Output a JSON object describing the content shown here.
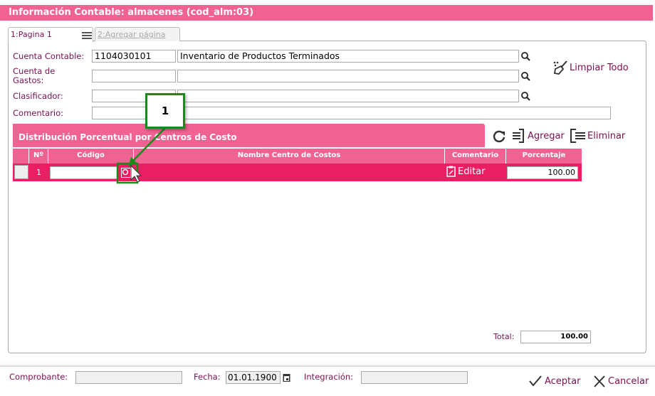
{
  "window": {
    "title": "Información Contable: almacenes (cod_alm:03)"
  },
  "tabs": [
    {
      "label": "1:Pagina 1"
    },
    {
      "label": "2:Agregar página"
    }
  ],
  "form": {
    "cuenta_contable": {
      "label": "Cuenta Contable:",
      "code": "1104030101",
      "name": "Inventario de Productos Terminados"
    },
    "cuenta_gastos": {
      "label": "Cuenta de Gastos:",
      "code": "",
      "name": ""
    },
    "clasificador": {
      "label": "Clasificador:",
      "code": "",
      "name": ""
    },
    "comentario": {
      "label": "Comentario:",
      "value": ""
    },
    "limpiar_label": "Limpiar Todo"
  },
  "section": {
    "title": "Distribución Porcentual por Centros de Costo",
    "agregar_label": "Agregar",
    "eliminar_label": "Eliminar"
  },
  "table": {
    "headers": [
      "Nº",
      "Código",
      "Nombre Centro de Costos",
      "Comentario",
      "Porcentaje"
    ],
    "rows": [
      {
        "n": "1",
        "codigo": "",
        "nombre": "",
        "comentario": "Editar",
        "porcentaje": "100.00"
      }
    ],
    "total_label": "Total:",
    "total": "100.00"
  },
  "callout": {
    "label": "1"
  },
  "footer": {
    "comprobante_label": "Comprobante:",
    "comprobante": "",
    "fecha_label": "Fecha:",
    "fecha": "01.01.1900",
    "integracion_label": "Integración:",
    "integracion": "",
    "aceptar_label": "Aceptar",
    "cancelar_label": "Cancelar"
  },
  "colors": {
    "accent": "#f06292",
    "row": "#e91e63",
    "label": "#7a1050",
    "callout": "#1a8a1a"
  }
}
